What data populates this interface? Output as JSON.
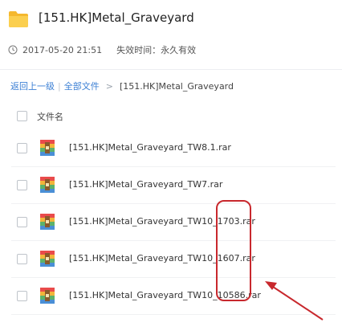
{
  "header": {
    "title": "[151.HK]Metal_Graveyard",
    "date": "2017-05-20 21:51",
    "expiry": "失效时间：永久有效"
  },
  "breadcrumb": {
    "back": "返回上一级",
    "separator": "|",
    "all_files": "全部文件",
    "arrow": ">",
    "current": "[151.HK]Metal_Graveyard"
  },
  "list": {
    "column_header": "文件名",
    "files": [
      {
        "name": "[151.HK]Metal_Graveyard_TW8.1.rar",
        "icon": "rar-archive-icon"
      },
      {
        "name": "[151.HK]Metal_Graveyard_TW7.rar",
        "icon": "rar-archive-icon"
      },
      {
        "name": "[151.HK]Metal_Graveyard_TW10_1703.rar",
        "icon": "rar-archive-icon"
      },
      {
        "name": "[151.HK]Metal_Graveyard_TW10_1607.rar",
        "icon": "rar-archive-icon"
      },
      {
        "name": "[151.HK]Metal_Graveyard_TW10_10586.rar",
        "icon": "rar-archive-icon"
      }
    ]
  },
  "colors": {
    "link": "#3b7fd4",
    "folder": "#f7c645",
    "annotation": "#c8282d"
  },
  "icons": {
    "folder": "folder-icon",
    "clock": "clock-icon"
  }
}
